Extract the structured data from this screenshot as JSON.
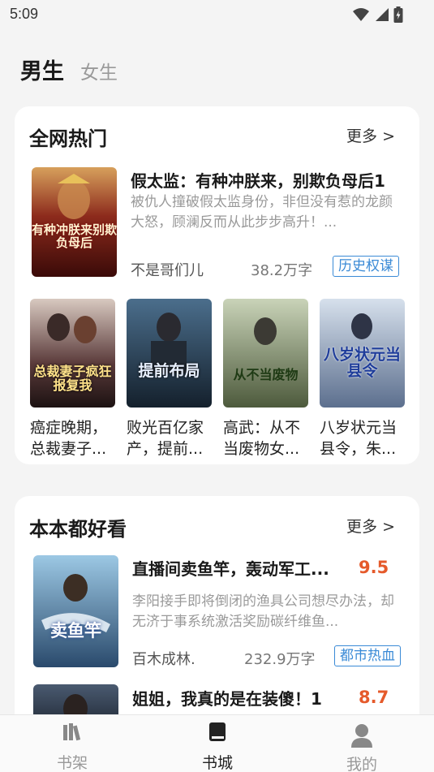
{
  "status_bar": {
    "time": "5:09"
  },
  "gender_tabs": {
    "active": "男生",
    "inactive": "女生"
  },
  "hot_section": {
    "title": "全网热门",
    "more": "更多 >",
    "featured": {
      "title": "假太监：有种冲朕来，别欺负母后1",
      "description": "被仇人撞破假太监身份，非但没有惹的龙颜大怒，顾澜反而从此步步高升！...",
      "author": "不是哥们儿",
      "word_count": "38.2万字",
      "tag": "历史权谋",
      "cover_text": "有种冲朕来别欺负母后"
    },
    "grid": [
      {
        "title": "癌症晚期，总裁妻子...",
        "cover_text": "总裁妻子疯狂报复我"
      },
      {
        "title": "败光百亿家产，提前...",
        "cover_text": "提前布局"
      },
      {
        "title": "高武：从不当废物女...",
        "cover_text": "从不当废物"
      },
      {
        "title": "八岁状元当县令，朱...",
        "cover_text": "八岁状元当县令"
      }
    ]
  },
  "good_section": {
    "title": "本本都好看",
    "more": "更多 >",
    "books": [
      {
        "title": "直播间卖鱼竿，轰动军工...",
        "score": "9.5",
        "description": "李阳接手即将倒闭的渔具公司想尽办法，却无济于事系统激活奖励碳纤维鱼...",
        "author": "百木成林.",
        "word_count": "232.9万字",
        "tag": "都市热血",
        "cover_text": "卖鱼竿"
      },
      {
        "title": "姐姐，我真的是在装傻！1",
        "score": "8.7"
      }
    ]
  },
  "bottom_nav": [
    {
      "label": "书架",
      "icon": "bookshelf-icon"
    },
    {
      "label": "书城",
      "icon": "book-icon"
    },
    {
      "label": "我的",
      "icon": "person-icon"
    }
  ],
  "colors": {
    "accent_tag": "#3a8ad6",
    "score": "#e55a2b",
    "card": "#ffffff",
    "background": "#f4f4f4"
  }
}
